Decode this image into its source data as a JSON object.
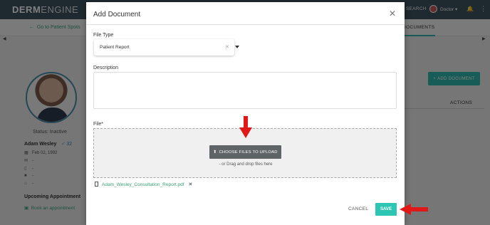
{
  "app": {
    "logo_bold": "DERM",
    "logo_light": "ENGINE",
    "search_label": "SEARCH",
    "user_label": "Doctor",
    "back_link": "Go to Patient Spots",
    "active_tab": "DOCUMENTS"
  },
  "patient": {
    "status": "Status: Inactive",
    "name": "Adam Wesley",
    "gender_age": "32",
    "dob": "Feb 02, 1992",
    "email": "-",
    "phone": "-",
    "work": "-",
    "home": "-",
    "upcoming_heading": "Upcoming Appointment",
    "book_link": "Book an appointment"
  },
  "documents": {
    "add_button": "ADD DOCUMENT",
    "actions_header": "ACTIONS"
  },
  "modal": {
    "title": "Add Document",
    "file_type_label": "File Type",
    "file_type_value": "Patient Report",
    "description_label": "Description",
    "description_value": "",
    "file_label": "File*",
    "upload_button": "CHOOSE FILES TO UPLOAD",
    "drop_hint": "- or Drag and drop files here",
    "attached_file": "Adam_Wesley_Consultation_Report.pdf",
    "cancel_label": "CANCEL",
    "save_label": "SAVE"
  },
  "colors": {
    "accent": "#2eb8ac",
    "link": "#3aa37a",
    "annotation": "#e01818"
  }
}
